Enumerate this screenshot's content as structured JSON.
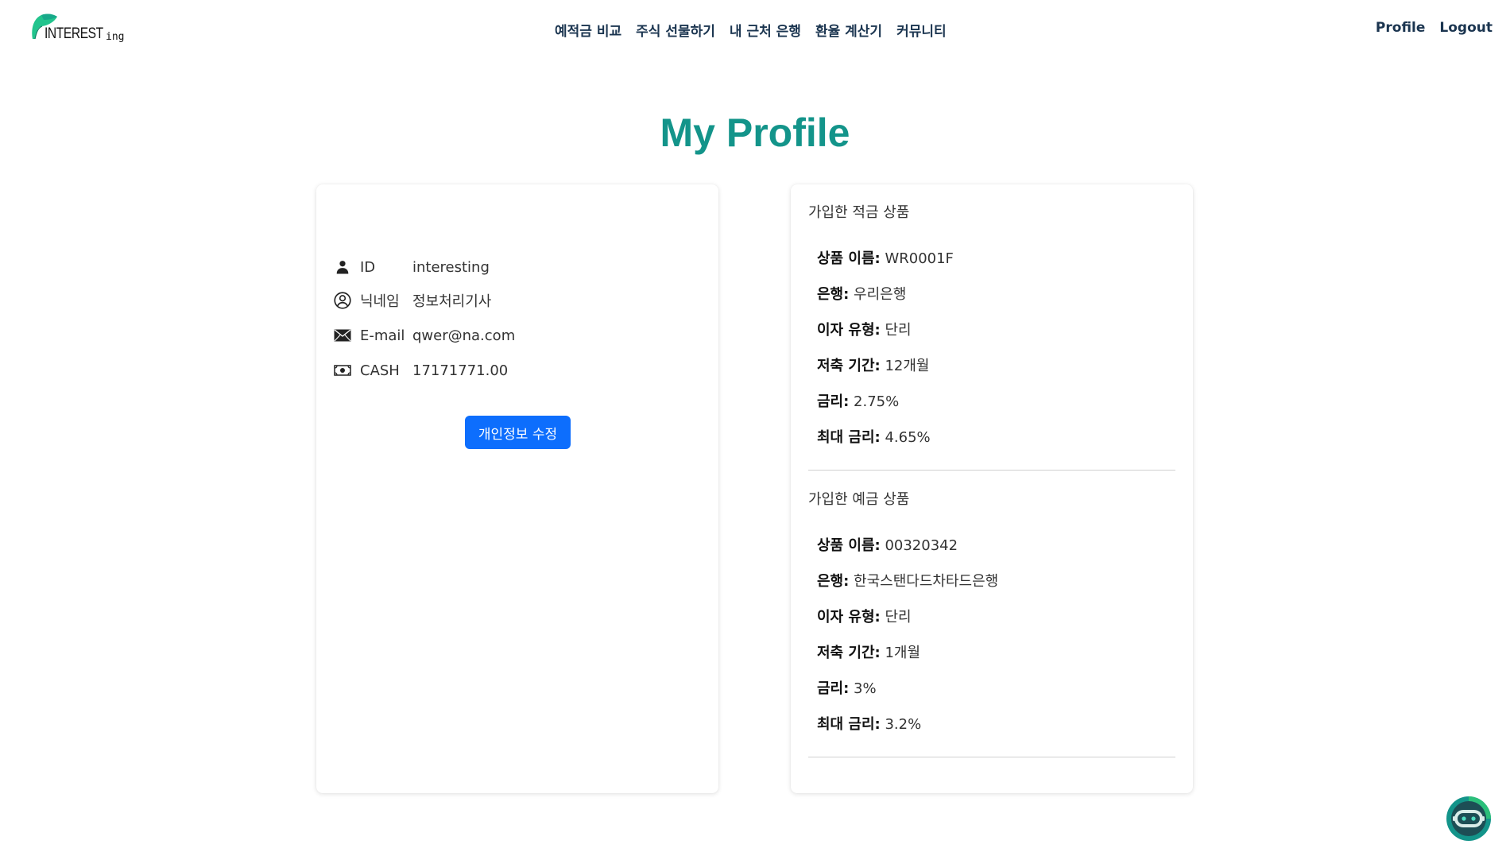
{
  "brand": {
    "logo_main": "INTEREST",
    "logo_suffix": "ing",
    "accent": "#13948a"
  },
  "nav": {
    "links": [
      "예적금 비교",
      "주식 선물하기",
      "내 근처 은행",
      "환율 계산기",
      "커뮤니티"
    ],
    "right": [
      "Profile",
      "Logout"
    ]
  },
  "page_title": "My Profile",
  "profile": {
    "rows": [
      {
        "icon": "person-icon",
        "label": "ID",
        "value": "interesting"
      },
      {
        "icon": "person-circle-icon",
        "label": "닉네임",
        "value": "정보처리기사"
      },
      {
        "icon": "envelope-icon",
        "label": "E-mail",
        "value": "qwer@na.com"
      },
      {
        "icon": "cash-icon",
        "label": "CASH",
        "value": "17171771.00"
      }
    ],
    "edit_button": "개인정보 수정"
  },
  "products": {
    "savings": {
      "heading": "가입한 적금 상품",
      "items": [
        {
          "k": "상품 이름:",
          "v": " WR0001F"
        },
        {
          "k": "은행:",
          "v": " 우리은행"
        },
        {
          "k": "이자 유형:",
          "v": " 단리"
        },
        {
          "k": "저축 기간:",
          "v": " 12개월"
        },
        {
          "k": "금리:",
          "v": " 2.75%"
        },
        {
          "k": "최대 금리:",
          "v": " 4.65%"
        }
      ]
    },
    "deposit": {
      "heading": "가입한 예금 상품",
      "items": [
        {
          "k": "상품 이름:",
          "v": " 00320342"
        },
        {
          "k": "은행:",
          "v": " 한국스탠다드차타드은행"
        },
        {
          "k": "이자 유형:",
          "v": " 단리"
        },
        {
          "k": "저축 기간:",
          "v": " 1개월"
        },
        {
          "k": "금리:",
          "v": " 3%"
        },
        {
          "k": "최대 금리:",
          "v": " 3.2%"
        }
      ]
    }
  }
}
